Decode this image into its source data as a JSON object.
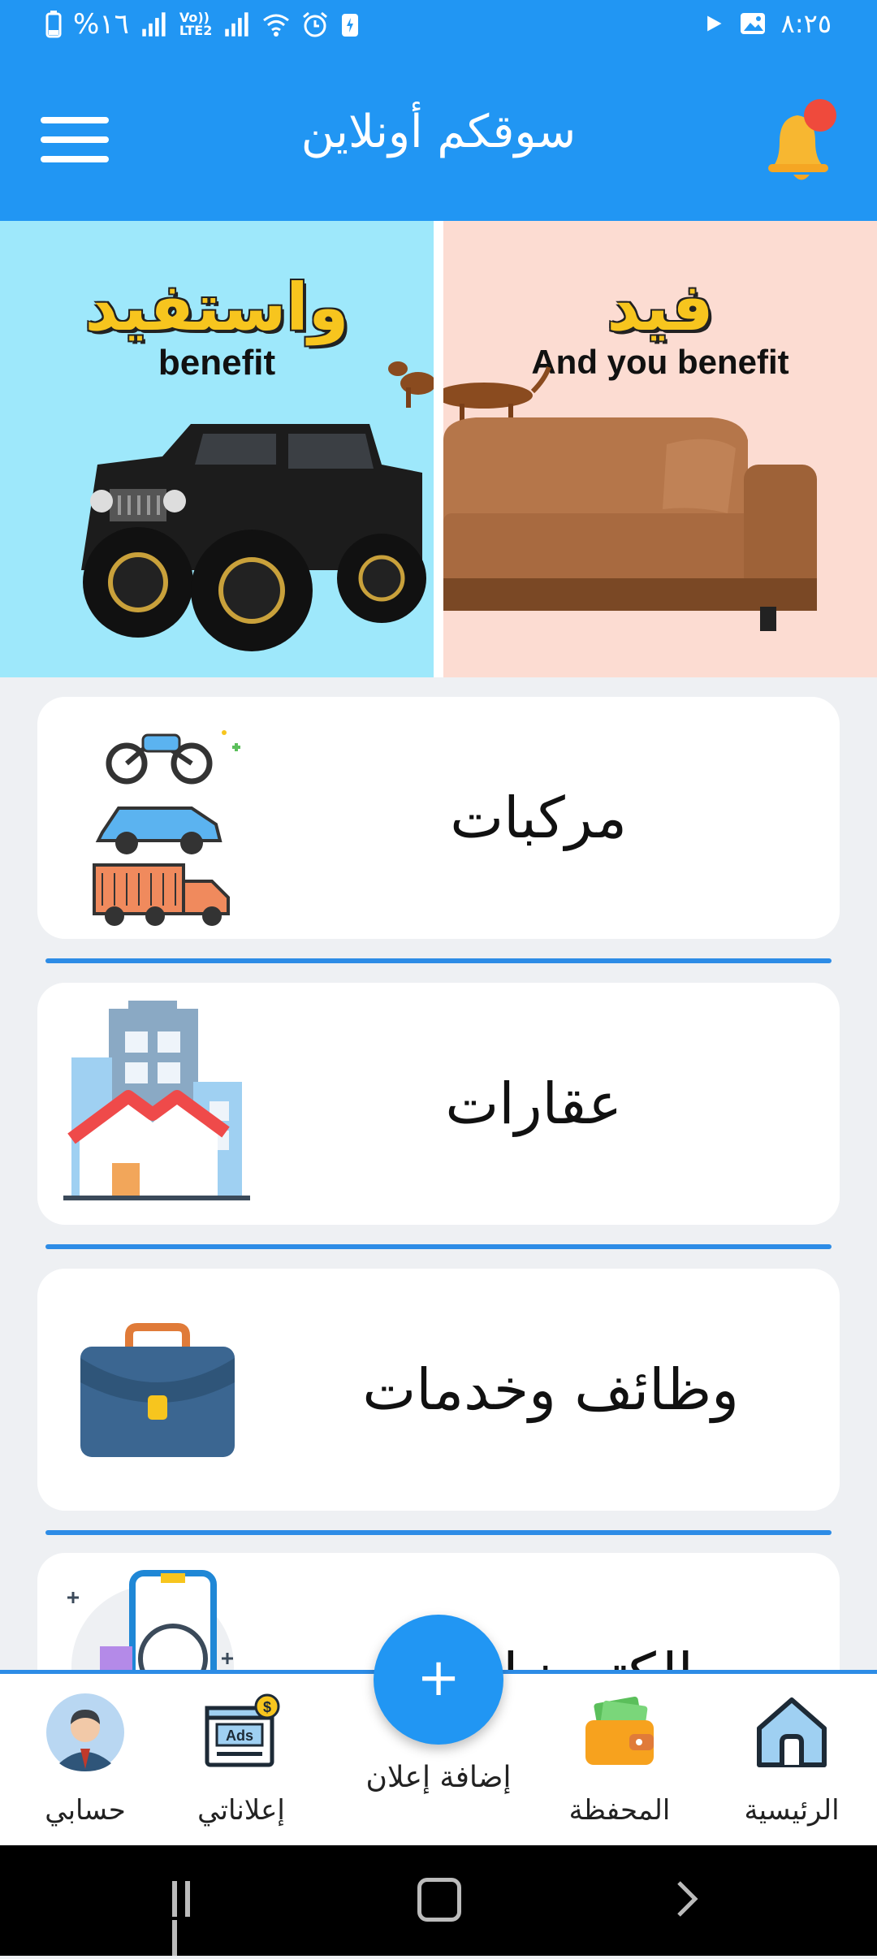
{
  "status_bar": {
    "battery": "%١٦",
    "network_type": "Vo)) LTE2",
    "time": "٨:٢٥"
  },
  "app_bar": {
    "title": "سوقكم أونلاين",
    "menu_icon": "hamburger-menu-icon",
    "notification_icon": "bell-icon"
  },
  "banner": {
    "left": {
      "arabic": "واستفيد",
      "english": "benefit"
    },
    "right": {
      "arabic": "فيد",
      "english": "And you benefit"
    }
  },
  "categories": [
    {
      "label": "مركبات",
      "icon": "vehicles-icon"
    },
    {
      "label": "عقارات",
      "icon": "real-estate-icon"
    },
    {
      "label": "وظائف وخدمات",
      "icon": "briefcase-icon"
    },
    {
      "label": "الكترونيات",
      "icon": "electronics-icon"
    }
  ],
  "bottom_nav": {
    "home": "الرئيسية",
    "wallet": "المحفظة",
    "add_ad": "إضافة إعلان",
    "my_ads": "إعلاناتي",
    "my_account": "حسابي",
    "ads_badge": "Ads",
    "fab_symbol": "+"
  },
  "colors": {
    "primary": "#2196F3",
    "separator": "#2d8ce6",
    "background": "#eef0f3"
  }
}
